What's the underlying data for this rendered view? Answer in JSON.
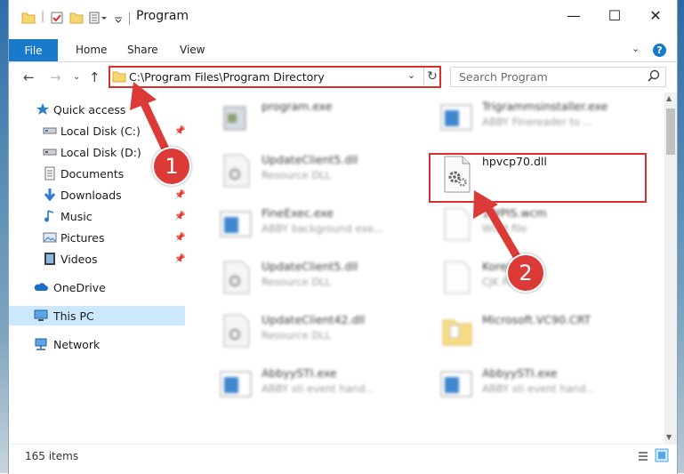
{
  "window": {
    "title": "Program",
    "controls": {
      "minimize": "—",
      "maximize": "☐",
      "close": "✕"
    }
  },
  "ribbon": {
    "tabs": [
      "File",
      "Home",
      "Share",
      "View"
    ],
    "expand": "⌄",
    "help": "?"
  },
  "address": {
    "path": "C:\\Program Files\\Program Directory",
    "search_placeholder": "Search Program"
  },
  "nav": {
    "items": [
      {
        "label": "Quick access",
        "icon": "star-icon"
      },
      {
        "label": "Local Disk (C:)",
        "icon": "drive-icon",
        "pinned": true
      },
      {
        "label": "Local Disk (D:)",
        "icon": "drive-icon"
      },
      {
        "label": "Documents",
        "icon": "documents-icon",
        "pinned": true
      },
      {
        "label": "Downloads",
        "icon": "download-icon",
        "pinned": true
      },
      {
        "label": "Music",
        "icon": "music-icon",
        "pinned": true
      },
      {
        "label": "Pictures",
        "icon": "pictures-icon",
        "pinned": true
      },
      {
        "label": "Videos",
        "icon": "videos-icon",
        "pinned": true
      },
      {
        "label": "OneDrive",
        "icon": "cloud-icon"
      },
      {
        "label": "This PC",
        "icon": "computer-icon",
        "selected": true
      },
      {
        "label": "Network",
        "icon": "network-icon"
      }
    ]
  },
  "files": [
    {
      "name": "program.exe",
      "desc": "",
      "type": "exe"
    },
    {
      "name": "Trigrammsinstaller.exe",
      "desc": "ABBY Finereader to ...",
      "type": "exe-blue"
    },
    {
      "name": "UpdateClient5.dll",
      "desc": "Resource DLL",
      "type": "dll"
    },
    {
      "name": "hpvcp70.dll",
      "desc": "",
      "type": "dll-gear"
    },
    {
      "name": "FineExec.exe",
      "desc": "ABBY background exe...",
      "type": "exe-blue"
    },
    {
      "name": "1WPIS.wcm",
      "desc": "WCM file",
      "type": "blank"
    },
    {
      "name": "UpdateClient5.dll",
      "desc": "Resource DLL",
      "type": "dll"
    },
    {
      "name": "Korea...",
      "desc": "CJK File",
      "type": "blank"
    },
    {
      "name": "UpdateClient42.dll",
      "desc": "Resource DLL",
      "type": "dll"
    },
    {
      "name": "Microsoft.VC90.CRT",
      "desc": "",
      "type": "folder"
    },
    {
      "name": "AbbyySTI.exe",
      "desc": "ABBY sti event hand...",
      "type": "exe-blue"
    },
    {
      "name": "AbbyySTI.exe",
      "desc": "ABBY sti event hand...",
      "type": "exe-blue"
    }
  ],
  "status": {
    "count": "165 items"
  },
  "callouts": [
    "1",
    "2"
  ],
  "colors": {
    "accent": "#1979ca",
    "annotation": "#dc3a36",
    "selected": "#cce8ff"
  }
}
